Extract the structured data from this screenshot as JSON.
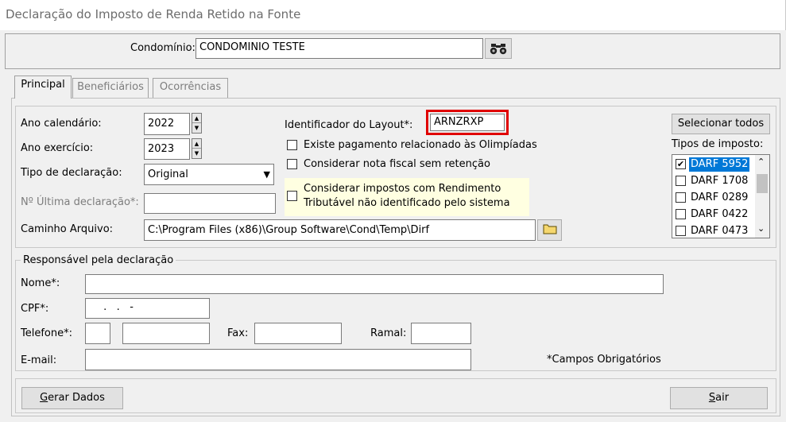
{
  "window": {
    "title": "Declaração do Imposto de Renda Retido na Fonte"
  },
  "header": {
    "condominio_label": "Condomínio:",
    "condominio_value": "CONDOMINIO TESTE",
    "search_icon": "binoculars-icon"
  },
  "tabs": [
    {
      "label": "Principal",
      "active": true
    },
    {
      "label": "Beneficiários",
      "active": false
    },
    {
      "label": "Ocorrências",
      "active": false
    }
  ],
  "principal": {
    "ano_calendario_label": "Ano calendário:",
    "ano_calendario_value": "2022",
    "ano_exercicio_label": "Ano exercício:",
    "ano_exercicio_value": "2023",
    "tipo_declaracao_label": "Tipo de declaração:",
    "tipo_declaracao_value": "Original",
    "ultima_declaracao_label": "Nº Última declaração*:",
    "ultima_declaracao_value": "",
    "caminho_label": "Caminho Arquivo:",
    "caminho_value": "C:\\Program Files (x86)\\Group Software\\Cond\\Temp\\Dirf",
    "folder_icon": "folder-icon",
    "layout_label": "Identificador do Layout*:",
    "layout_value": "ARNZRXP",
    "olimpiadas_label": "Existe pagamento relacionado às Olimpíadas",
    "olimpiadas_checked": false,
    "nota_fiscal_label": "Considerar nota fiscal sem retenção",
    "nota_fiscal_checked": false,
    "impostos_label_1": "Considerar impostos com Rendimento",
    "impostos_label_2": "Tributável não identificado pelo sistema",
    "impostos_checked": false,
    "selecionar_todos_label": "Selecionar todos",
    "tipos_imposto_label": "Tipos de imposto:",
    "tipos_imposto": [
      {
        "label": "DARF 5952",
        "checked": true,
        "selected": true
      },
      {
        "label": "DARF 1708",
        "checked": false,
        "selected": false
      },
      {
        "label": "DARF 0289",
        "checked": false,
        "selected": false
      },
      {
        "label": "DARF 0422",
        "checked": false,
        "selected": false
      },
      {
        "label": "DARF 0473",
        "checked": false,
        "selected": false
      }
    ]
  },
  "responsavel": {
    "group_label": "Responsável pela declaração",
    "nome_label": "Nome*:",
    "nome_value": "",
    "cpf_label": "CPF*:",
    "cpf_value": " .   .   -",
    "telefone_label": "Telefone*:",
    "telefone_ddd": "",
    "telefone_numero": "",
    "fax_label": "Fax:",
    "fax_value": "",
    "ramal_label": "Ramal:",
    "ramal_value": "",
    "email_label": "E-mail:",
    "email_value": "",
    "obrigatorios_note": "*Campos Obrigatórios"
  },
  "footer": {
    "gerar_label": "Gerar Dados",
    "sair_label": "Sair"
  },
  "colors": {
    "highlight_border": "#e00000",
    "selection_bg": "#0078d7",
    "note_bg": "#ffffe1"
  }
}
